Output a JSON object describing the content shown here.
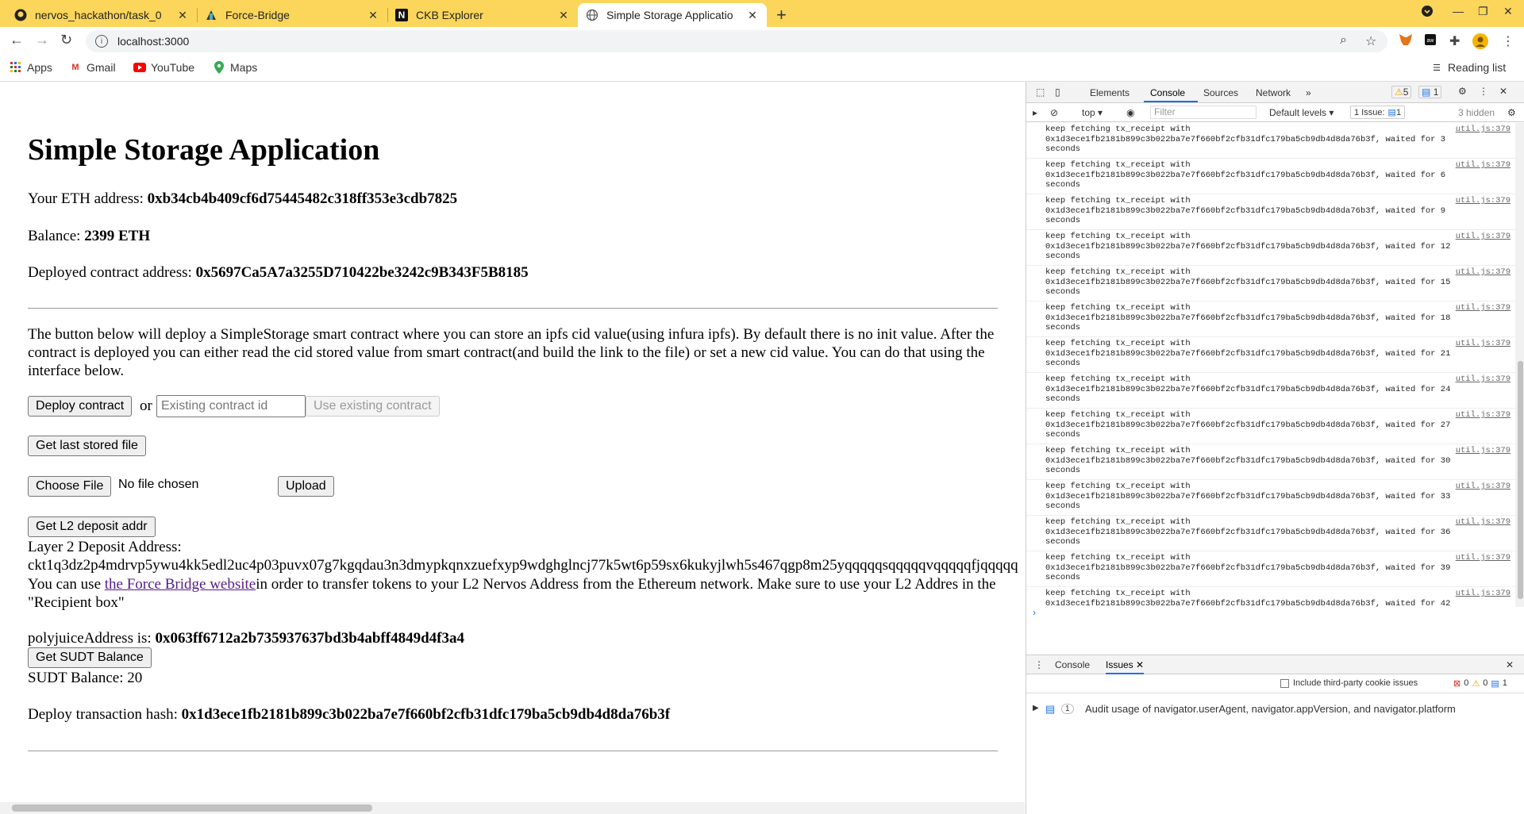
{
  "browser": {
    "tabs": [
      {
        "title": "nervos_hackathon/task_0",
        "icon": "github-icon"
      },
      {
        "title": "Force-Bridge",
        "icon": "force-bridge-icon"
      },
      {
        "title": "CKB Explorer",
        "icon": "ckb-icon"
      },
      {
        "title": "Simple Storage Applicatio",
        "icon": "globe-icon"
      }
    ],
    "url": "localhost:3000",
    "bookmarks": [
      {
        "label": "Apps",
        "icon": "apps-grid-icon"
      },
      {
        "label": "Gmail",
        "icon": "gmail-icon"
      },
      {
        "label": "YouTube",
        "icon": "youtube-icon"
      },
      {
        "label": "Maps",
        "icon": "maps-icon"
      }
    ],
    "reading_list": "Reading list"
  },
  "page": {
    "title": "Simple Storage Application",
    "eth_address_label": "Your ETH address: ",
    "eth_address": "0xb34cb4b409cf6d75445482c318ff353e3cdb7825",
    "balance_label": "Balance: ",
    "balance": "2399 ETH",
    "contract_label": "Deployed contract address: ",
    "contract_address": "0x5697Ca5A7a3255D710422be3242c9B343F5B8185",
    "description": "The button below will deploy a SimpleStorage smart contract where you can store an ipfs cid value(using infura ipfs). By default there is no init value. After the contract is deployed you can either read the cid stored value from smart contract(and build the link to the file) or set a new cid value. You can do that using the interface below.",
    "deploy_button": "Deploy contract",
    "or_text": "or",
    "existing_placeholder": "Existing contract id",
    "use_existing_button": "Use existing contract",
    "get_last_button": "Get last stored file",
    "choose_file_button": "Choose File",
    "no_file_text": "No file chosen",
    "upload_button": "Upload",
    "get_l2_button": "Get L2 deposit addr",
    "l2_label": "Layer 2 Deposit Address:",
    "l2_address": "ckt1q3dz2p4mdrvp5ywu4kk5edl2uc4p03puvx07g7kgqdau3n3dmypkqnxzuefxyp9wdghglncj77k5wt6p59sx6kukyjlwh5s467qgp8m25yqqqqqsqqqqqvqqqqqfjqqqqq",
    "force_bridge_pre": "You can use ",
    "force_bridge_link": "the Force Bridge website",
    "force_bridge_post": "in order to transfer tokens to your L2 Nervos Address from the Ethereum network. Make sure to use your L2 Addres in the \"Recipient box\"",
    "polyjuice_label": "polyjuiceAddress is: ",
    "polyjuice_address": "0x063ff6712a2b735937637bd3b4abff4849d4f3a4",
    "get_sudt_button": "Get SUDT Balance",
    "sudt_balance": "SUDT Balance: 20",
    "deploy_hash_label": "Deploy transaction hash: ",
    "deploy_hash": "0x1d3ece1fb2181b899c3b022ba7e7f660bf2cfb31dfc179ba5cb9db4d8da76b3f"
  },
  "devtools": {
    "tabs": [
      "Elements",
      "Console",
      "Sources",
      "Network"
    ],
    "warnings": "5",
    "messages": "1",
    "context": "top",
    "filter_placeholder": "Filter",
    "levels": "Default levels",
    "issues_badge": "1 Issue:",
    "issues_count": "1",
    "hidden": "3 hidden",
    "log_source": "util.js:379",
    "log_line1": "keep fetching tx_receipt with",
    "log_hash": "0x1d3ece1fb2181b899c3b022ba7e7f660bf2cfb31dfc179ba5cb9db4d8da76b3f, waited for",
    "log_seconds_word": "seconds",
    "log_waits": [
      "3",
      "6",
      "9",
      "12",
      "15",
      "18",
      "21",
      "24",
      "27",
      "30",
      "33",
      "36",
      "39",
      "42"
    ],
    "drawer_tabs": [
      "Console",
      "Issues"
    ],
    "third_party_label": "Include third-party cookie issues",
    "issue_counts": [
      "0",
      "0",
      "1"
    ],
    "issue_row_count": "1",
    "issue_text": "Audit usage of navigator.userAgent, navigator.appVersion, and navigator.platform"
  }
}
